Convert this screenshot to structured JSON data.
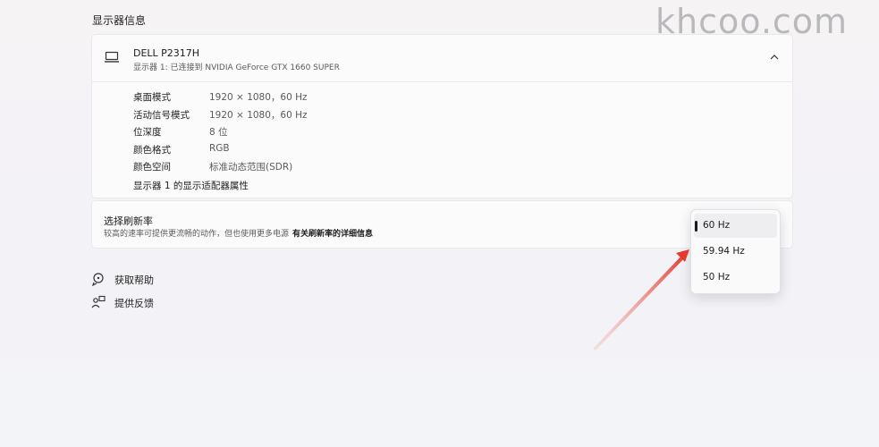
{
  "watermark": "khcoo.com",
  "section_title": "显示器信息",
  "monitor": {
    "name": "DELL P2317H",
    "subtitle": "显示器 1: 已连接到 NVIDIA GeForce GTX 1660 SUPER",
    "details": [
      {
        "label": "桌面模式",
        "value": "1920 × 1080，60 Hz"
      },
      {
        "label": "活动信号模式",
        "value": "1920 × 1080，60 Hz"
      },
      {
        "label": "位深度",
        "value": "8 位"
      },
      {
        "label": "颜色格式",
        "value": "RGB"
      },
      {
        "label": "颜色空间",
        "value": "标准动态范围(SDR)"
      }
    ],
    "adapter_link": "显示器 1 的显示适配器属性"
  },
  "refresh": {
    "title": "选择刷新率",
    "description": "较高的速率可提供更流畅的动作，但也使用更多电源",
    "link": "有关刷新率的详细信息",
    "options": [
      "60 Hz",
      "59.94 Hz",
      "50 Hz"
    ],
    "selected": "60 Hz"
  },
  "help": {
    "get_help": "获取帮助",
    "feedback": "提供反馈"
  },
  "colors": {
    "arrow": "#e23b2e",
    "background": "#f4f3f6",
    "panel": "#fbfbfc"
  }
}
